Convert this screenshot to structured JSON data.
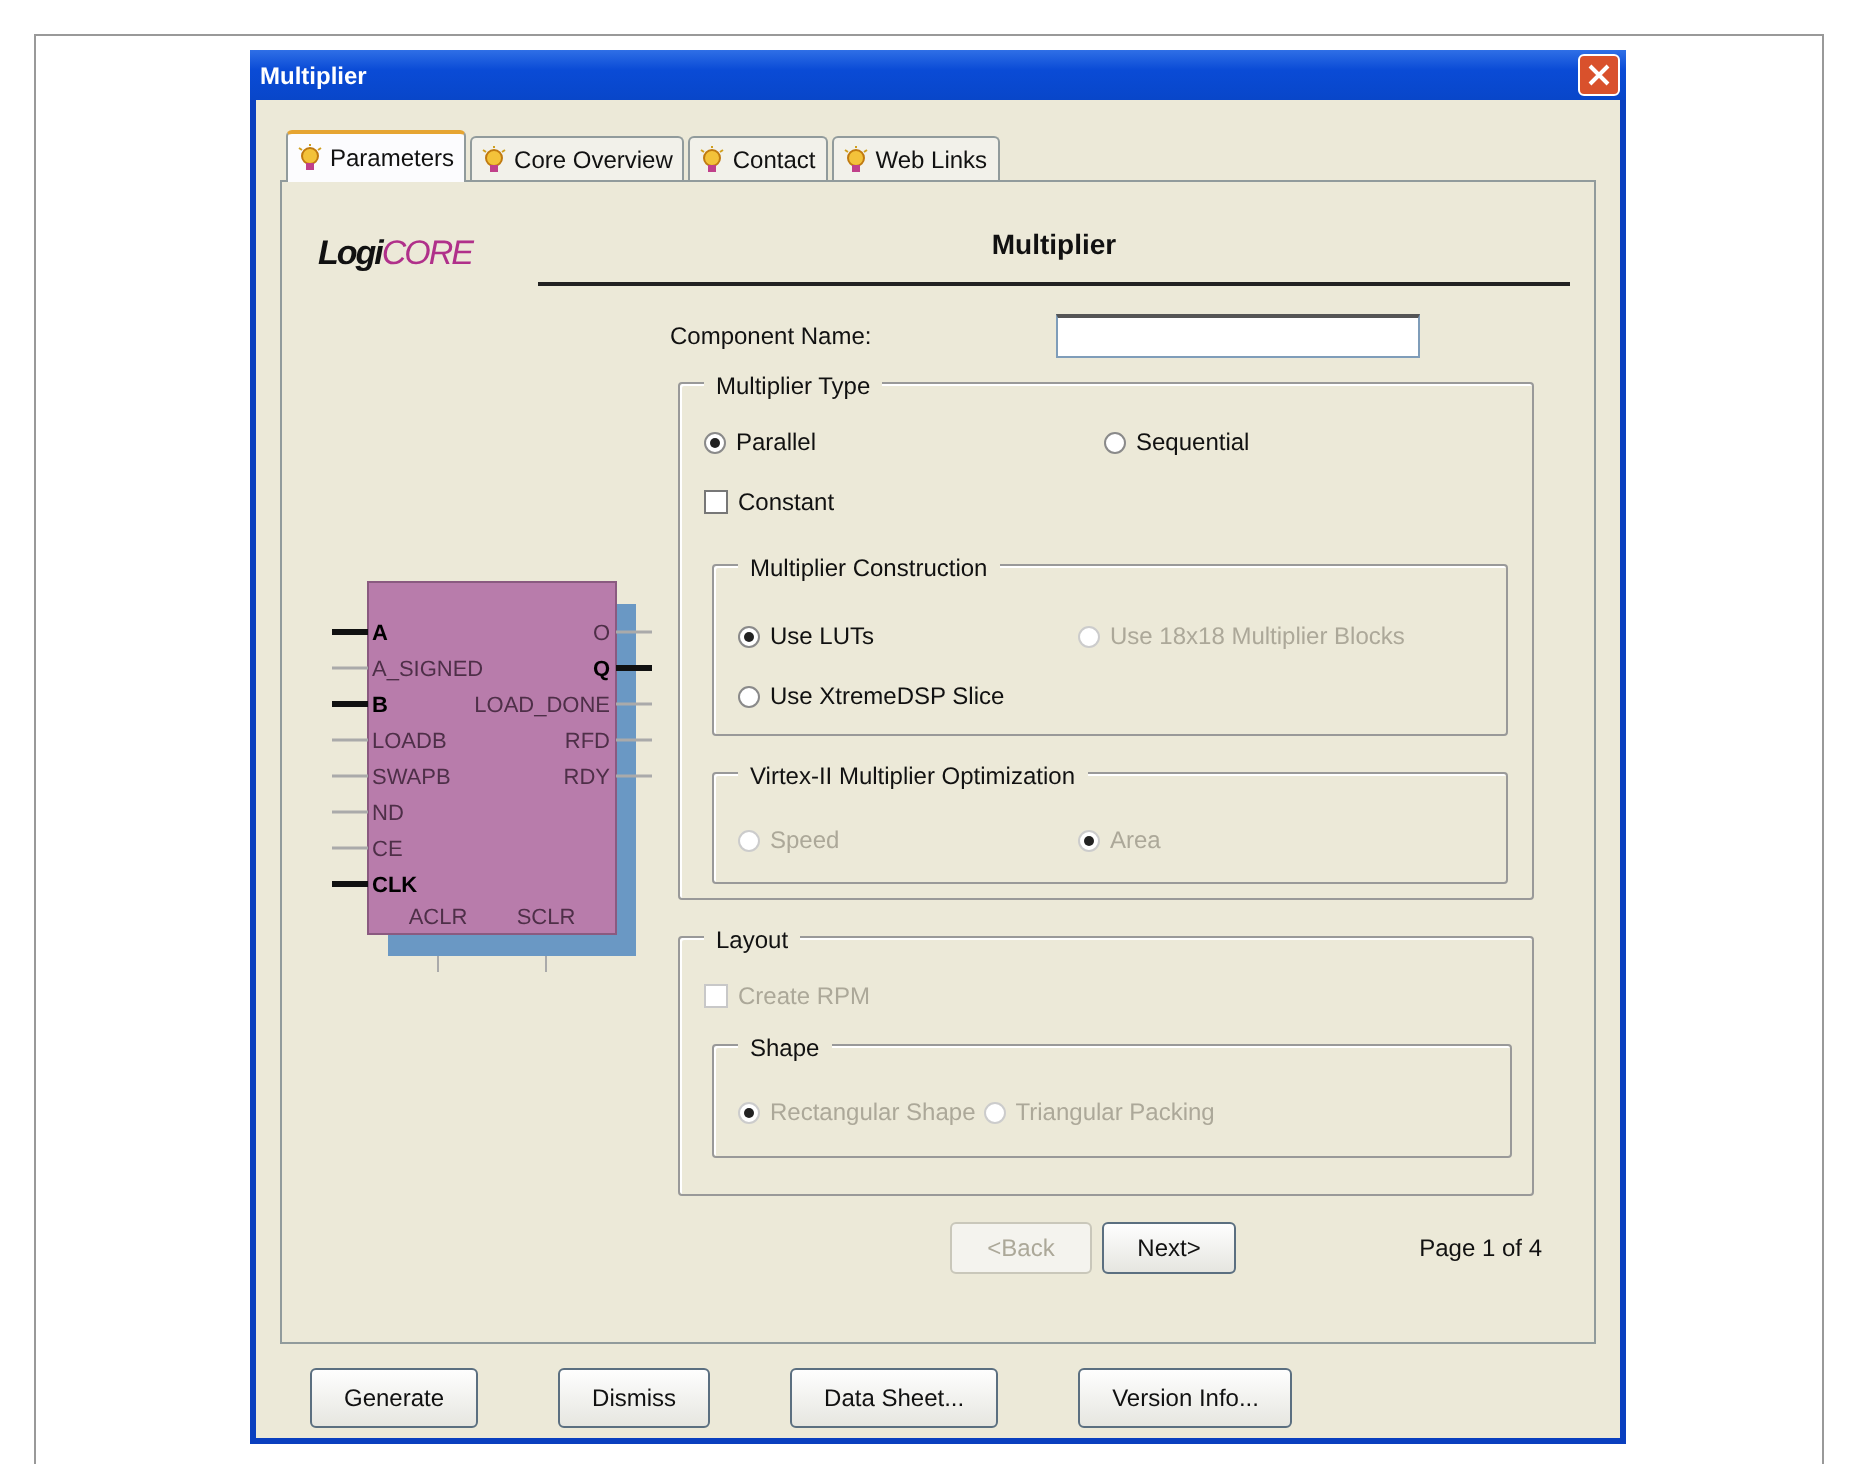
{
  "window": {
    "title": "Multiplier"
  },
  "tabs": [
    {
      "label": "Parameters",
      "selected": true
    },
    {
      "label": "Core Overview",
      "selected": false
    },
    {
      "label": "Contact",
      "selected": false
    },
    {
      "label": "Web Links",
      "selected": false
    }
  ],
  "logo": {
    "prefix": "Logi",
    "suffix": "CORE"
  },
  "heading": "Multiplier",
  "symbol": {
    "left_pins": [
      {
        "name": "A",
        "active": true
      },
      {
        "name": "A_SIGNED",
        "active": false
      },
      {
        "name": "B",
        "active": true
      },
      {
        "name": "LOADB",
        "active": false
      },
      {
        "name": "SWAPB",
        "active": false
      },
      {
        "name": "ND",
        "active": false
      },
      {
        "name": "CE",
        "active": false
      },
      {
        "name": "CLK",
        "active": true
      }
    ],
    "right_pins": [
      {
        "name": "O",
        "active": false
      },
      {
        "name": "Q",
        "active": true
      },
      {
        "name": "LOAD_DONE",
        "active": false
      },
      {
        "name": "RFD",
        "active": false
      },
      {
        "name": "RDY",
        "active": false
      }
    ],
    "bottom_pins": [
      {
        "name": "ACLR",
        "active": false
      },
      {
        "name": "SCLR",
        "active": false
      }
    ]
  },
  "component_name": {
    "label": "Component Name:"
  },
  "multiplier_type": {
    "title": "Multiplier Type",
    "options": [
      {
        "label": "Parallel",
        "selected": true,
        "disabled": false
      },
      {
        "label": "Sequential",
        "selected": false,
        "disabled": false
      }
    ],
    "constant": {
      "label": "Constant",
      "checked": false,
      "disabled": false
    },
    "construction": {
      "title": "Multiplier Construction",
      "options": [
        {
          "label": "Use LUTs",
          "selected": true,
          "disabled": false
        },
        {
          "label": "Use 18x18 Multiplier Blocks",
          "selected": false,
          "disabled": true
        },
        {
          "label": "Use XtremeDSP Slice",
          "selected": false,
          "disabled": false
        }
      ]
    },
    "optimization": {
      "title": "Virtex-II Multiplier Optimization",
      "options": [
        {
          "label": "Speed",
          "selected": false,
          "disabled": true
        },
        {
          "label": "Area",
          "selected": true,
          "disabled": true
        }
      ]
    }
  },
  "layout": {
    "title": "Layout",
    "create_rpm": {
      "label": "Create RPM",
      "checked": false,
      "disabled": true
    },
    "shape": {
      "title": "Shape",
      "options": [
        {
          "label": "Rectangular Shape",
          "selected": true,
          "disabled": true
        },
        {
          "label": "Triangular Packing",
          "selected": false,
          "disabled": true
        }
      ]
    }
  },
  "navigation": {
    "back": {
      "label": "<Back",
      "disabled": true
    },
    "next": {
      "label": "Next>",
      "disabled": false
    },
    "page": "Page 1 of 4"
  },
  "buttons": [
    "Generate",
    "Dismiss",
    "Data Sheet...",
    "Version Info..."
  ]
}
